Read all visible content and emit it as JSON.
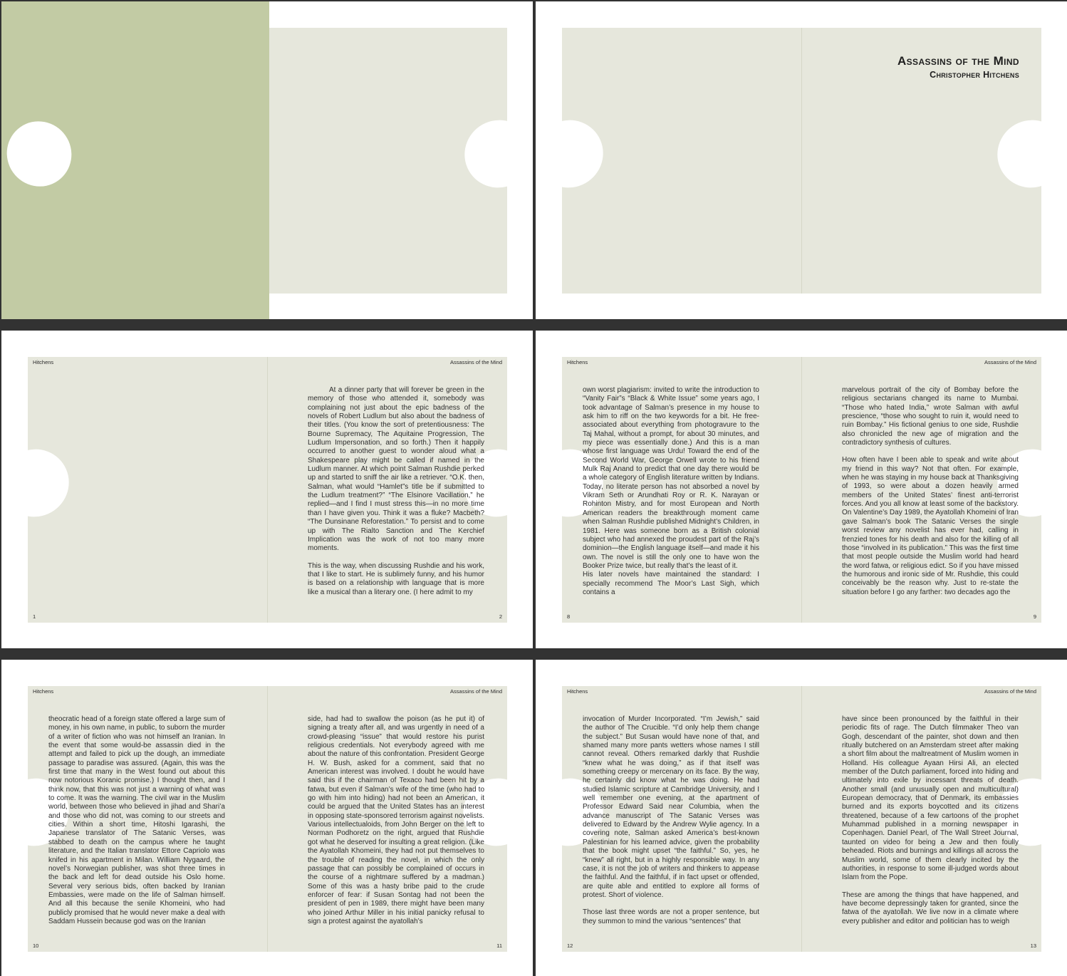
{
  "colors": {
    "background": "#323232",
    "page": "#e6e7dc",
    "cover": "#c2cba4",
    "shape": "#ffffff"
  },
  "title": {
    "main": "Assassins of the Mind",
    "author": "Christopher Hitchens"
  },
  "spreads": [
    {
      "header_left": "Hitchens",
      "header_right": "Assassins of the Mind",
      "page_left": "1",
      "page_right": "2",
      "left_text": [],
      "right_text": [
        "At a dinner party that will forever be green in the memory of those who attended it, somebody was complaining not just about the epic badness of the novels of Robert Ludlum but also about the badness of their titles. (You know the sort of pretentiousness: The Bourne Supremacy, The Aquitaine Progression, The Ludlum Impersonation, and so forth.) Then it happily occurred to another guest to wonder aloud what a Shakespeare play might be called if named in the Ludlum manner. At which point Salman Rushdie perked up and started to sniff the air like a retriever. “O.K. then, Salman, what would “Hamlet”s title be if submitted to the Ludlum treatment?” “The Elsinore Vacillation,” he replied—and I find I must stress this—in no more time than I have given you. Think it was a fluke? Macbeth? “The Dunsinane Reforestation.” To persist and to come up with The Rialto Sanction and The Kerchief Implication was the work of not too many more moments.",
        "This is the way, when discussing Rushdie and his work, that I like to start. He is sublimely funny, and his humor is based on a relationship with language that is more like a musical than a literary one. (I here admit to my"
      ]
    },
    {
      "header_left": "Hitchens",
      "header_right": "Assassins of the Mind",
      "page_left": "8",
      "page_right": "9",
      "left_text": [
        "own worst plagiarism: invited to write the introduction to “Vanity Fair”s “Black & White Issue” some years ago, I took advantage of Salman’s presence in my house to ask him to riff on the two keywords for a bit. He free-associated about everything from photogravure to the Taj Mahal, without a prompt, for about 30 minutes, and my piece was essentially done.) And this is a man whose first language was Urdu! Toward the end of the Second World War, George Orwell wrote to his friend Mulk Raj Anand to predict that one day there would be a whole category of English literature written by Indians. Today, no literate person has not absorbed a novel by Vikram Seth or Arundhati Roy or R. K. Narayan or Rohinton Mistry, and for most European and North American readers the breakthrough moment came when Salman Rushdie published Midnight’s Children, in 1981. Here was someone born as a British colonial subject who had annexed the proudest part of the Raj’s dominion—the English language itself—and made it his own. The novel is still the only one to have won the Booker Prize twice, but really that’s the least of it.",
        "His later novels have maintained the standard: I specially recommend The Moor’s Last Sigh, which contains a"
      ],
      "right_text": [
        "marvelous portrait of the city of Bombay before the religious sectarians changed its name to Mumbai. “Those who hated India,” wrote Salman with awful prescience, “those who sought to ruin it, would need to ruin Bombay.” His fictional genius to one side, Rushdie also chronicled the new age of migration and the contradictory synthesis of cultures.",
        "How often have I been able to speak and write about my friend in this way? Not that often. For example, when he was staying in my house back at Thanksgiving of 1993, so were about a dozen heavily armed members of the United States’ finest anti-terrorist forces. And you all know at least some of the backstory. On Valentine’s Day 1989, the Ayatollah Khomeini of Iran gave Salman’s book The Satanic Verses the single worst review any novelist has ever had, calling in frenzied tones for his death and also for the killing of all those “involved in its publication.” This was the first time that most people outside the Muslim world had heard the word fatwa, or religious edict. So if you have missed the humorous and ironic side of Mr. Rushdie, this could conceivably be the reason why. Just to re-state the situation before I go any farther: two decades ago the"
      ]
    },
    {
      "header_left": "Hitchens",
      "header_right": "Assassins of the Mind",
      "page_left": "10",
      "page_right": "11",
      "left_text": [
        "theocratic head of a foreign state offered a large sum of money, in his own name, in public, to suborn the murder of a writer of fiction who was not himself an Iranian. In the event that some would-be assassin died in the attempt and failed to pick up the dough, an immediate passage to paradise was assured. (Again, this was the first time that many in the West found out about this now notorious Koranic promise.) I thought then, and I think now, that this was not just a warning of what was to come. It was the warning. The civil war in the Muslim world, between those who believed in jihad and Shari’a and those who did not, was coming to our streets and cities. Within a short time, Hitoshi Igarashi, the Japanese translator of The Satanic Verses, was stabbed to death on the campus where he taught literature, and the Italian translator Ettore Capriolo was knifed in his apartment in Milan. William Nygaard, the novel’s Norwegian publisher, was shot three times in the back and left for dead outside his Oslo home. Several very serious bids, often backed by Iranian Embassies, were made on the life of Salman himself. And all this because the senile Khomeini, who had publicly promised that he would never make a deal with Saddam Hussein because god was on the Iranian"
      ],
      "right_text": [
        "side, had had to swallow the poison (as he put it) of signing a treaty after all, and was urgently in need of a crowd-pleasing “issue” that would restore his purist religious credentials. Not everybody agreed with me about the nature of this confrontation. President George H. W. Bush, asked for a comment, said that no American interest was involved. I doubt he would have said this if the chairman of Texaco had been hit by a fatwa, but even if Salman’s wife of the time (who had to go with him into hiding) had not been an American, it could be argued that the United States has an interest in opposing state-sponsored terrorism against novelists. Various intellectualoids, from John Berger on the left to Norman Podhoretz on the right, argued that Rushdie got what he deserved for insulting a great religion. (Like the Ayatollah Khomeini, they had not put themselves to the trouble of reading the novel, in which the only passage that can possibly be complained of occurs in the course of a nightmare suffered by a madman.) Some of this was a hasty bribe paid to the crude enforcer of fear: if Susan Sontag had not been the president of pen in 1989, there might have been many who joined Arthur Miller in his initial panicky refusal to sign a protest against the ayatollah’s"
      ]
    },
    {
      "header_left": "Hitchens",
      "header_right": "Assassins of the Mind",
      "page_left": "12",
      "page_right": "13",
      "left_text": [
        "invocation of Murder Incorporated. “I’m Jewish,” said the author of The Crucible. “I’d only help them change the subject.” But Susan would have none of that, and shamed many more pants wetters whose names I still cannot reveal. Others remarked darkly that Rushdie “knew what he was doing,” as if that itself was something creepy or mercenary on its face. By the way, he certainly did know what he was doing. He had studied Islamic scripture at Cambridge University, and I well remember one evening, at the apartment of Professor Edward Said near Columbia, when the advance manuscript of The Satanic Verses was delivered to Edward by the Andrew Wylie agency. In a covering note, Salman asked America’s best-known Palestinian for his learned advice, given the probability that the book might upset “the faithful.” So, yes, he “knew” all right, but in a highly responsible way. In any case, it is not the job of writers and thinkers to appease the faithful. And the faithful, if in fact upset or offended, are quite able and entitled to explore all forms of protest. Short of violence.",
        "Those last three words are not a proper sentence, but they summon to mind the various “sentences” that"
      ],
      "right_text": [
        "have since been pronounced by the faithful in their periodic fits of rage. The Dutch filmmaker Theo van Gogh, descendant of the painter, shot down and then ritually butchered on an Amsterdam street after making a short film about the maltreatment of Muslim women in Holland. His colleague Ayaan Hirsi Ali, an elected member of the Dutch parliament, forced into hiding and ultimately into exile by incessant threats of death. Another small (and unusually open and multicultural) European democracy, that of Denmark, its embassies burned and its exports boycotted and its citizens threatened, because of a few cartoons of the prophet Muhammad published in a morning newspaper in Copenhagen. Daniel Pearl, of The Wall Street Journal, taunted on video for being a Jew and then foully beheaded. Riots and burnings and killings all across the Muslim world, some of them clearly incited by the authorities, in response to some ill-judged words about Islam from the Pope.",
        "These are among the things that have happened, and have become depressingly taken for granted, since the fatwa of the ayatollah. We live now in a climate where every publisher and editor and politician has to weigh"
      ]
    }
  ]
}
